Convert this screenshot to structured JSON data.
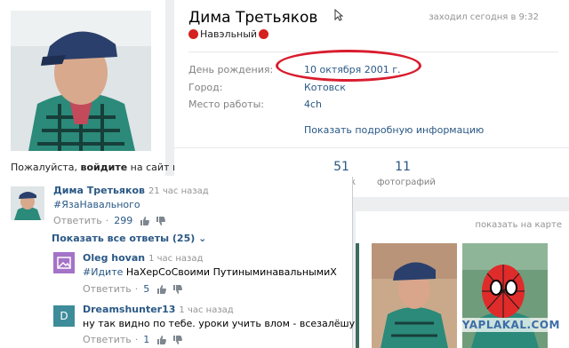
{
  "profile": {
    "name": "Дима Третьяков",
    "status_text": "Навэльный",
    "last_seen": "заходил сегодня в 9:32",
    "info": [
      {
        "label": "День рождения:",
        "value": "10 октября 2001 г."
      },
      {
        "label": "Город:",
        "value": "Котовск"
      },
      {
        "label": "Место работы:",
        "value": "4ch"
      }
    ],
    "more_link": "Показать подробную информацию",
    "counts": [
      {
        "number": "51",
        "label": "к"
      },
      {
        "number": "11",
        "label": "фотографий"
      }
    ]
  },
  "sidebar": {
    "login_prefix": "Пожалуйста, ",
    "login_bold": "войдите",
    "login_suffix": " на сайт или"
  },
  "photos": {
    "map_link": "показать на карте",
    "watermark": "YAPLAKAL.COM"
  },
  "comments": {
    "main": {
      "author": "Дима Третьяков",
      "time": "21 час назад",
      "text": "#ЯзаНавального",
      "reply_label": "Ответить",
      "likes": "299"
    },
    "show_all": "Показать все ответы (25)",
    "replies": [
      {
        "author": "Oleg hovan",
        "time": "1 час назад",
        "tag": "#Идите",
        "text": " НаХерСоСвоими ПутиныминавальнымиX",
        "reply_label": "Ответить",
        "likes": "5",
        "avatar_color": "#a473c7"
      },
      {
        "author": "Dreamshunter13",
        "time": "1 час назад",
        "letter": "D",
        "text": "ну так видно по тебе. уроки учить влом - всезалёшу",
        "reply_label": "Ответить",
        "likes": "1",
        "avatar_color": "#3e8c9a"
      }
    ]
  }
}
